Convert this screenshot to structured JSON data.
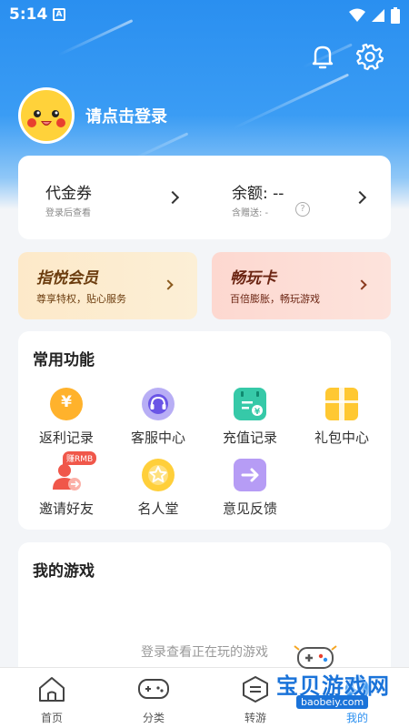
{
  "status_bar": {
    "time": "5:14",
    "a_icon": "A"
  },
  "header": {
    "login_text": "请点击登录"
  },
  "wallet": {
    "voucher_title": "代金券",
    "voucher_sub": "登录后查看",
    "balance_title": "余额: --",
    "balance_sub": "含赠送: -"
  },
  "promos": [
    {
      "title": "指悦会员",
      "sub": "尊享特权，贴心服务",
      "color": "#6b3c0e"
    },
    {
      "title": "畅玩卡",
      "sub": "百倍膨胀，畅玩游戏",
      "color": "#6b2412"
    }
  ],
  "functions": {
    "title": "常用功能",
    "items": [
      {
        "label": "返利记录",
        "icon": "rebate-icon"
      },
      {
        "label": "客服中心",
        "icon": "customer-service-icon"
      },
      {
        "label": "充值记录",
        "icon": "recharge-record-icon"
      },
      {
        "label": "礼包中心",
        "icon": "gift-pack-icon"
      },
      {
        "label": "邀请好友",
        "icon": "invite-friends-icon",
        "badge": "赚RMB"
      },
      {
        "label": "名人堂",
        "icon": "hall-of-fame-icon"
      },
      {
        "label": "意见反馈",
        "icon": "feedback-icon"
      }
    ]
  },
  "games": {
    "title": "我的游戏",
    "empty_text": "登录查看正在玩的游戏"
  },
  "tabbar": [
    {
      "label": "首页",
      "icon": "home-icon"
    },
    {
      "label": "分类",
      "icon": "gamepad-icon"
    },
    {
      "label": "转游",
      "icon": "transfer-icon"
    },
    {
      "label": "我的",
      "icon": "profile-icon",
      "active": true
    }
  ],
  "watermark": {
    "text": "宝贝游戏网",
    "url": "baobeiy.com"
  },
  "colors": {
    "primary": "#2a8ff0",
    "vip_bg": "#fde9c9",
    "card_bg": "#fdd8d0"
  }
}
